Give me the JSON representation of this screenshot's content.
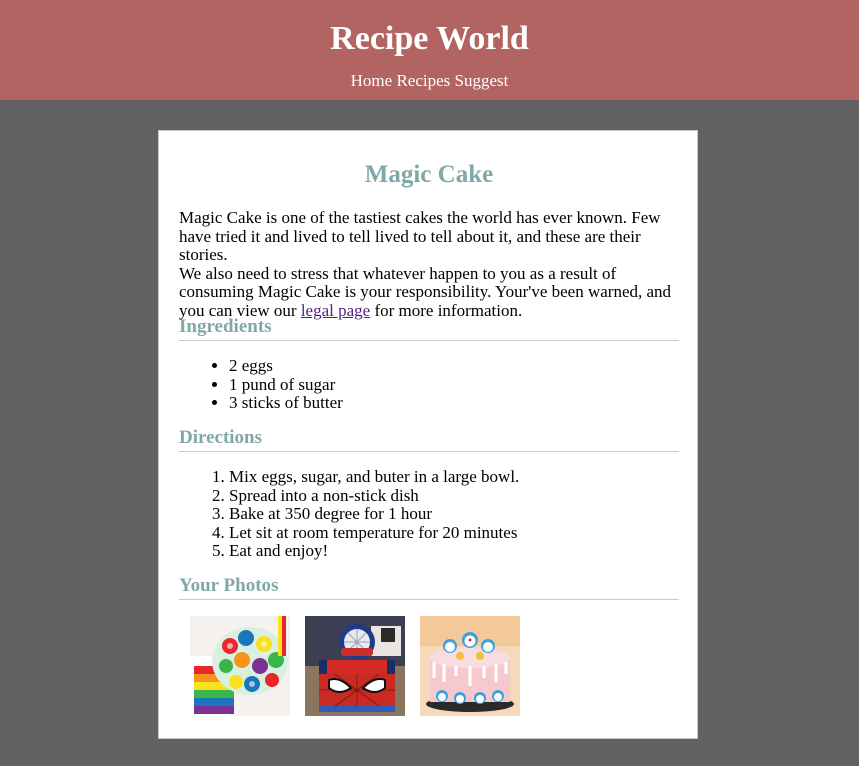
{
  "header": {
    "title": "Recipe World",
    "nav": [
      "Home",
      "Recipes",
      "Suggest"
    ]
  },
  "recipe": {
    "title": "Magic Cake",
    "intro_line1": "Magic Cake is one of the tastiest cakes the world has ever known. Few have tried it and lived to tell lived to tell about it, and these are their stories.",
    "intro_line2_prefix": "We also need to stress that whatever happen to you as a result of consuming Magic Cake is your responsibility. Your've been warned, and you can view our ",
    "intro_link": "legal page",
    "intro_line2_suffix": " for more information.",
    "ingredients_heading": "Ingredients",
    "ingredients": [
      "2 eggs",
      "1 pund of sugar",
      "3 sticks of butter"
    ],
    "directions_heading": "Directions",
    "directions": [
      "Mix eggs, sugar, and buter in a large bowl.",
      "Spread into a non-stick dish",
      "Bake at 350 degree for 1 hour",
      "Let sit at room temperature for 20 minutes",
      "Eat and enjoy!"
    ],
    "photos_heading": "Your Photos",
    "photos": [
      "rainbow-cake-photo",
      "spiderman-cake-photo",
      "doraemon-cake-photo"
    ]
  },
  "colors": {
    "header_bg": "#b16461",
    "page_bg": "#616161",
    "accent": "#7fa8a6",
    "link": "#551a8b"
  }
}
